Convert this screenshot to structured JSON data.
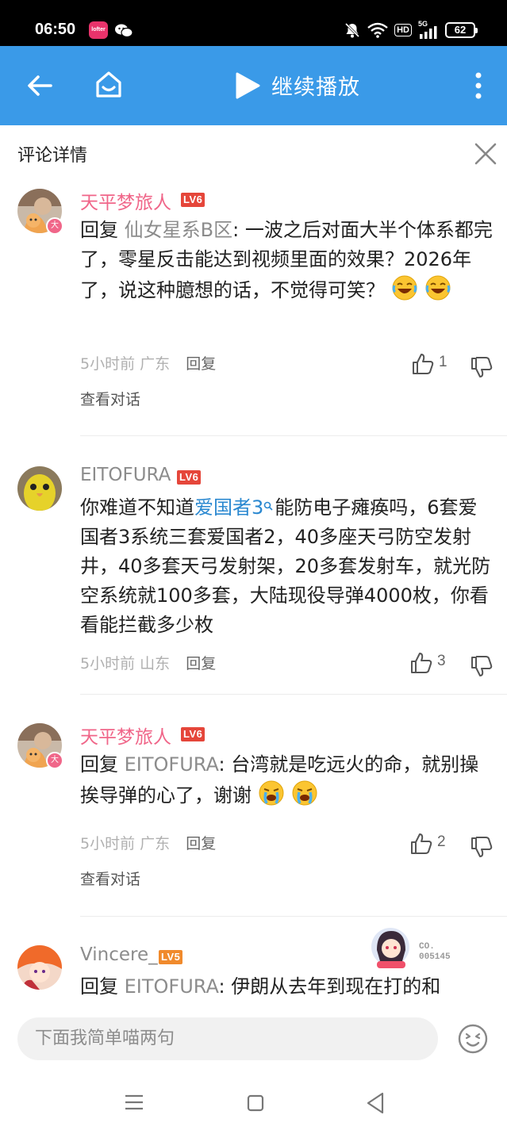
{
  "status_bar": {
    "time": "06:50",
    "app1_label": "lofter",
    "network": "5G",
    "hd": "HD",
    "battery": "62"
  },
  "nav": {
    "title": "继续播放",
    "bg_color": "#3a9ae8"
  },
  "detail": {
    "title": "评论详情"
  },
  "comments": [
    {
      "username": "天平梦旅人",
      "level": "LV6",
      "avatar_badge": "大",
      "reply_prefix": "回复 ",
      "reply_to": "仙女星系B区",
      "colon": ": ",
      "text": "一波之后对面大半个体系都完了，零星反击能达到视频里面的效果？2026年了，说这种臆想的话，不觉得可笑？",
      "emojis": [
        "laugh-cry-emoji",
        "laugh-cry-emoji"
      ],
      "time": "5小时前",
      "location": "广东",
      "reply_label": "回复",
      "likes": "1",
      "view_conversation": "查看对话"
    },
    {
      "username": "EITOFURA",
      "level": "LV6",
      "text_before": "你难道不知道",
      "link": "爱国者3",
      "text_after": "能防电子瘫痪吗，6套爱国者3系统三套爱国者2，40多座天弓防空发射井，40多套天弓发射架，20多套发射车，就光防空系统就100多套，大陆现役导弹4000枚，你看看能拦截多少枚",
      "time": "5小时前",
      "location": "山东",
      "reply_label": "回复",
      "likes": "3"
    },
    {
      "username": "天平梦旅人",
      "level": "LV6",
      "avatar_badge": "大",
      "reply_prefix": "回复 ",
      "reply_to": "EITOFURA",
      "colon": ": ",
      "text": "台湾就是吃远火的命，就别操挨导弹的心了，谢谢",
      "emojis": [
        "crying-emoji",
        "crying-emoji"
      ],
      "time": "5小时前",
      "location": "广东",
      "reply_label": "回复",
      "likes": "2",
      "view_conversation": "查看对话"
    },
    {
      "username": "Vincere_",
      "level": "LV5",
      "reply_prefix": "回复 ",
      "reply_to": "EITOFURA",
      "colon": ": ",
      "text": "伊朗从去年到现在打的和"
    }
  ],
  "sticker": {
    "line1": "CO.",
    "line2": "005145"
  },
  "input": {
    "placeholder": "下面我简单喵两句"
  }
}
